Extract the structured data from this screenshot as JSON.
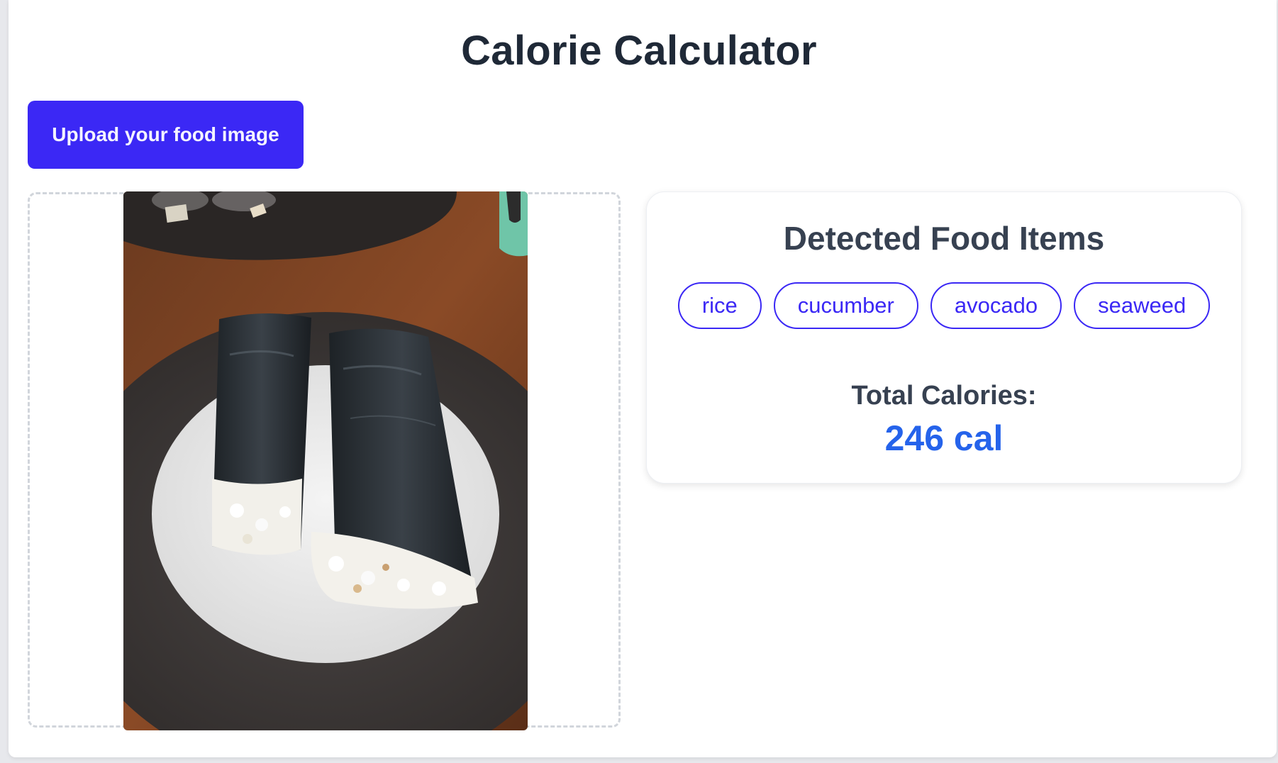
{
  "app": {
    "title": "Calorie Calculator"
  },
  "upload": {
    "button_label": "Upload your food image"
  },
  "image": {
    "description_alt": "sushi rolls on plate"
  },
  "results": {
    "heading": "Detected Food Items",
    "items": [
      "rice",
      "cucumber",
      "avocado",
      "seaweed"
    ],
    "total_label": "Total Calories:",
    "total_value": "246 cal"
  },
  "colors": {
    "accent": "#3b28f5",
    "calorie_value": "#2563eb",
    "heading_text": "#1f2937"
  }
}
